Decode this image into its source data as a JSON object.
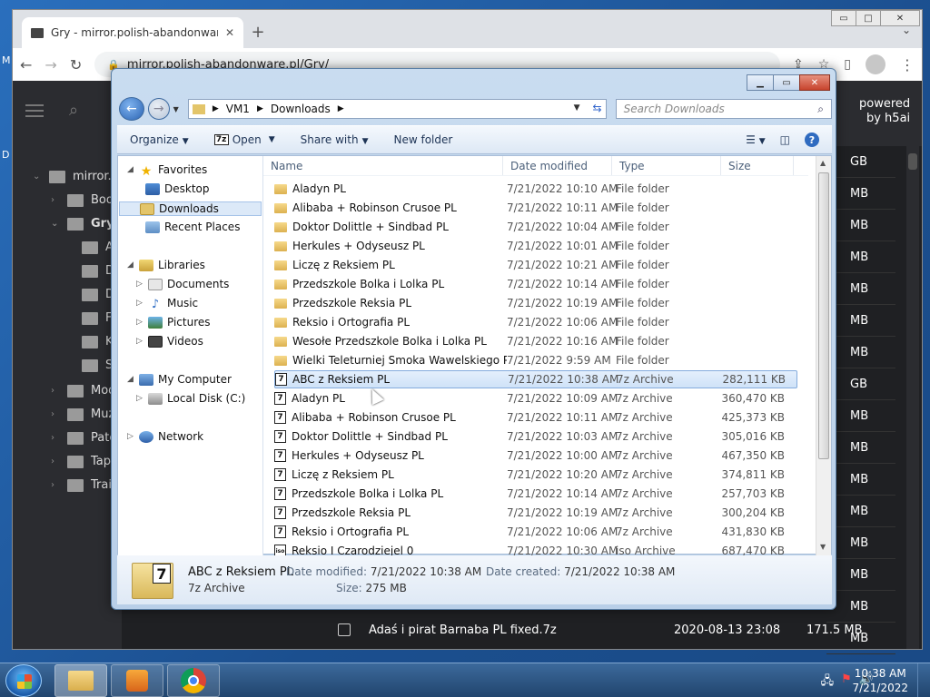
{
  "desktop": {
    "icons": [
      "M",
      "D"
    ]
  },
  "browser": {
    "tab_title": "Gry - mirror.polish-abandonware",
    "url": "mirror.polish-abandonware.pl/Gry/",
    "page": {
      "powered": "powered",
      "by": "by h5ai",
      "tree": [
        {
          "label": "mirror.p"
        },
        {
          "label": "Boo"
        },
        {
          "label": "Gry"
        },
        {
          "label": "A"
        },
        {
          "label": "D"
        },
        {
          "label": "D"
        },
        {
          "label": "F"
        },
        {
          "label": "K"
        },
        {
          "label": "S"
        },
        {
          "label": "Mod"
        },
        {
          "label": "Muz"
        },
        {
          "label": "Patc"
        },
        {
          "label": "Tape"
        },
        {
          "label": "Trail"
        }
      ],
      "sizes": [
        "GB",
        "MB",
        "MB",
        "MB",
        "MB",
        "MB",
        "MB",
        "GB",
        "MB",
        "MB",
        "MB",
        "MB",
        "MB",
        "MB",
        "MB",
        "MB"
      ],
      "bottom_row": {
        "name": "Adaś i pirat Barnaba PL fixed.7z",
        "date": "2020-08-13 23:08",
        "size": "171.5 MB"
      }
    }
  },
  "explorer": {
    "breadcrumb": [
      "VM1",
      "Downloads"
    ],
    "search_placeholder": "Search Downloads",
    "commands": {
      "organize": "Organize",
      "open": "Open",
      "share": "Share with",
      "new_folder": "New folder"
    },
    "nav": [
      {
        "label": "Favorites",
        "icon": "star-icon"
      },
      {
        "label": "Desktop",
        "icon": "desktop-icon"
      },
      {
        "label": "Downloads",
        "icon": "downloads-icon"
      },
      {
        "label": "Recent Places",
        "icon": "recent-places-icon"
      },
      {
        "label": "Libraries",
        "icon": "libraries-icon"
      },
      {
        "label": "Documents",
        "icon": "documents-icon"
      },
      {
        "label": "Music",
        "icon": "music-icon"
      },
      {
        "label": "Pictures",
        "icon": "pictures-icon"
      },
      {
        "label": "Videos",
        "icon": "videos-icon"
      },
      {
        "label": "My Computer",
        "icon": "computer-icon"
      },
      {
        "label": "Local Disk (C:)",
        "icon": "disk-icon"
      },
      {
        "label": "Network",
        "icon": "network-icon"
      }
    ],
    "columns": {
      "name": "Name",
      "date": "Date modified",
      "type": "Type",
      "size": "Size"
    },
    "files": [
      {
        "name": "Aladyn PL",
        "date": "7/21/2022 10:10 AM",
        "type": "File folder",
        "size": ""
      },
      {
        "name": "Alibaba + Robinson Crusoe PL",
        "date": "7/21/2022 10:11 AM",
        "type": "File folder",
        "size": ""
      },
      {
        "name": "Doktor Dolittle + Sindbad PL",
        "date": "7/21/2022 10:04 AM",
        "type": "File folder",
        "size": ""
      },
      {
        "name": "Herkules + Odyseusz PL",
        "date": "7/21/2022 10:01 AM",
        "type": "File folder",
        "size": ""
      },
      {
        "name": "Liczę z Reksiem PL",
        "date": "7/21/2022 10:21 AM",
        "type": "File folder",
        "size": ""
      },
      {
        "name": "Przedszkole Bolka i Lolka PL",
        "date": "7/21/2022 10:14 AM",
        "type": "File folder",
        "size": ""
      },
      {
        "name": "Przedszkole Reksia PL",
        "date": "7/21/2022 10:19 AM",
        "type": "File folder",
        "size": ""
      },
      {
        "name": "Reksio i Ortografia PL",
        "date": "7/21/2022 10:06 AM",
        "type": "File folder",
        "size": ""
      },
      {
        "name": "Wesołe Przedszkole Bolka i Lolka PL",
        "date": "7/21/2022 10:16 AM",
        "type": "File folder",
        "size": ""
      },
      {
        "name": "Wielki Teleturniej Smoka Wawelskiego PL",
        "date": "7/21/2022 9:59 AM",
        "type": "File folder",
        "size": ""
      },
      {
        "name": "ABC z Reksiem PL",
        "date": "7/21/2022 10:38 AM",
        "type": "7z Archive",
        "size": "282,111 KB",
        "selected": true
      },
      {
        "name": "Aladyn PL",
        "date": "7/21/2022 10:09 AM",
        "type": "7z Archive",
        "size": "360,470 KB"
      },
      {
        "name": "Alibaba + Robinson Crusoe PL",
        "date": "7/21/2022 10:11 AM",
        "type": "7z Archive",
        "size": "425,373 KB"
      },
      {
        "name": "Doktor Dolittle + Sindbad PL",
        "date": "7/21/2022 10:03 AM",
        "type": "7z Archive",
        "size": "305,016 KB"
      },
      {
        "name": "Herkules + Odyseusz PL",
        "date": "7/21/2022 10:00 AM",
        "type": "7z Archive",
        "size": "467,350 KB"
      },
      {
        "name": "Liczę z Reksiem PL",
        "date": "7/21/2022 10:20 AM",
        "type": "7z Archive",
        "size": "374,811 KB"
      },
      {
        "name": "Przedszkole Bolka i Lolka PL",
        "date": "7/21/2022 10:14 AM",
        "type": "7z Archive",
        "size": "257,703 KB"
      },
      {
        "name": "Przedszkole Reksia PL",
        "date": "7/21/2022 10:19 AM",
        "type": "7z Archive",
        "size": "300,204 KB"
      },
      {
        "name": "Reksio i Ortografia PL",
        "date": "7/21/2022 10:06 AM",
        "type": "7z Archive",
        "size": "431,830 KB"
      },
      {
        "name": "Reksio I Czarodziejel 0",
        "date": "7/21/2022 10:30 AM",
        "type": "iso Archive",
        "size": "687,470 KB"
      }
    ],
    "details": {
      "name": "ABC z Reksiem PL",
      "type": "7z Archive",
      "modified_label": "Date modified:",
      "modified": "7/21/2022 10:38 AM",
      "created_label": "Date created:",
      "created": "7/21/2022 10:38 AM",
      "size_label": "Size:",
      "size": "275 MB"
    }
  },
  "taskbar": {
    "time": "10:38 AM",
    "date": "7/21/2022"
  }
}
